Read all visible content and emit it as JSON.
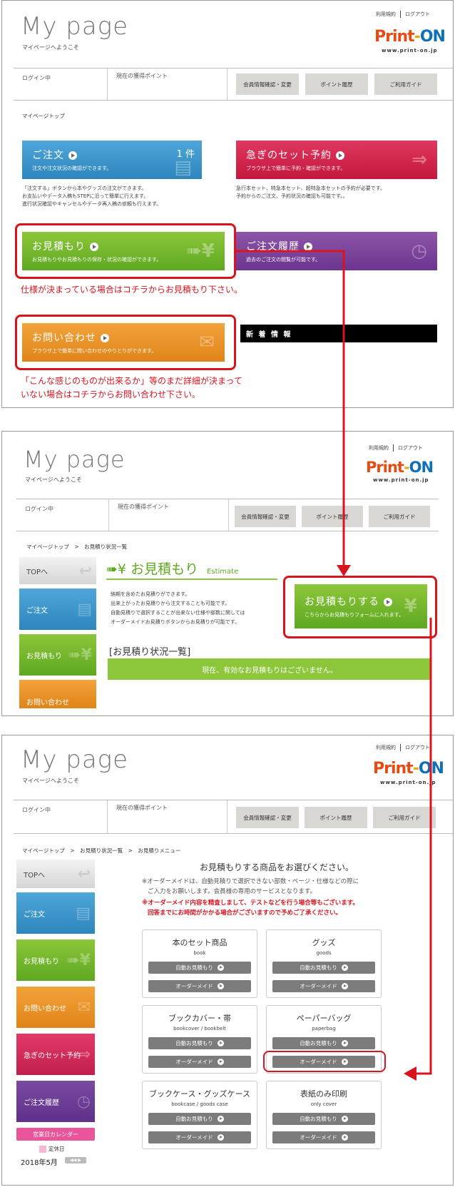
{
  "common": {
    "title": "My page",
    "subtitle": "マイページへようこそ",
    "terms_link": "利用規約",
    "logout_link": "ログアウト",
    "logo": {
      "p": "Print",
      "dash": "-",
      "on": "ON"
    },
    "logo_url": "www.print-on.jp",
    "login_label": "ログイン中",
    "points_label": "現在の獲得ポイント",
    "btn_member": "会員情報確認・変更",
    "btn_points": "ポイント履歴",
    "btn_guide": "ご利用ガイド",
    "side_top": "TOPへ",
    "side_order": "ご注文",
    "side_estimate": "お見積もり",
    "side_inquiry": "お問い合わせ",
    "side_set": "急ぎのセット予約",
    "side_history": "ご注文履歴"
  },
  "panel1": {
    "breadcrumb": "マイページトップ",
    "order": {
      "title": "ご注文",
      "sub": "注文や注文状況の確認ができます。",
      "count": "1 件"
    },
    "order_note": [
      "「注文する」ボタンから本やグッズの注文ができます。",
      "お支払いやデータ入稿もSTEPに沿って簡単に行えます。",
      "進行状況確認やキャンセルやデータ再入稿の依頼も行えます。"
    ],
    "set": {
      "title": "急ぎのセット予約",
      "sub": "ブラウザ上で簡単に予約・確認ができます。"
    },
    "set_note": [
      "急行本セット、特急本セット、超特急本セットの予約が必要です。",
      "予約からのご注文、予約状況の確認も可能です。。"
    ],
    "estimate": {
      "title": "お見積もり",
      "sub": "お見積もりやお見積もりの保存・状況の確認ができます。"
    },
    "history": {
      "title": "ご注文履歴",
      "sub": "過去のご注文の閲覧が可能です。"
    },
    "estimate_note": "仕様が決まっている場合はコチラからお見積もり下さい。",
    "inquiry": {
      "title": "お問い合わせ",
      "sub": "ブラウザ上で簡単に問い合わせのやりとりができます。"
    },
    "news": "新 着 情 報",
    "inquiry_note": [
      "「こんな感じのものが出来るか」等のまだ詳細が決まって",
      "いない場合はコチラからお問い合わせ下さい。"
    ]
  },
  "panel2": {
    "breadcrumb": "マイページトップ　>　お見積り状況一覧",
    "heading": "お見積もり",
    "heading_en": "Estimate",
    "desc": [
      "納期を含めたお見積りができます。",
      "出来上がったお見積りから注文することも可能です。",
      "自動見積りで選択することが出来ない仕様や部数に関しては",
      "オーダーメイドお見積りボタンからお見積りが可能です。"
    ],
    "cta": {
      "title": "お見積もりする",
      "sub": "こちらからお見積もりフォームに入れます。"
    },
    "list_heading": "[お見積り状況一覧]",
    "empty": "現在、有効なお見積もりはございません。"
  },
  "panel3": {
    "breadcrumb": "マイページトップ　>　お見積り状況一覧　>　お見積りメニュー",
    "heading": "お見積もりする商品をお選びください。",
    "note1": [
      "※オーダーメイドは、自動見積りで選択できない部数・ページ・仕様などの際に",
      "ご入力をお願いします。会員様の専用のサービスとなります。"
    ],
    "note2": [
      "※オーダーメイド内容を精査しまして、テストなどを行う場合等もございます。",
      "回答までにお時間がかかる場合がございますので予めご了承ください。"
    ],
    "auto_label": "自動お見積もり",
    "custom_label": "オーダーメイド",
    "products": [
      {
        "title": "本のセット商品",
        "sub": "book"
      },
      {
        "title": "グッズ",
        "sub": "goods"
      },
      {
        "title": "ブックカバー・帯",
        "sub": "bookcover / bookbelt"
      },
      {
        "title": "ペーパーバッグ",
        "sub": "paperbag"
      },
      {
        "title": "ブックケース・グッズケース",
        "sub": "bookcase / goods case"
      },
      {
        "title": "表紙のみ印刷",
        "sub": "only cover"
      }
    ],
    "calendar_btn": "営業日カレンダー",
    "holiday": "定休日",
    "month": "2018年5月"
  },
  "colors": {
    "accent_red": "#d8141f",
    "estimate_green": "#8cc63a"
  }
}
